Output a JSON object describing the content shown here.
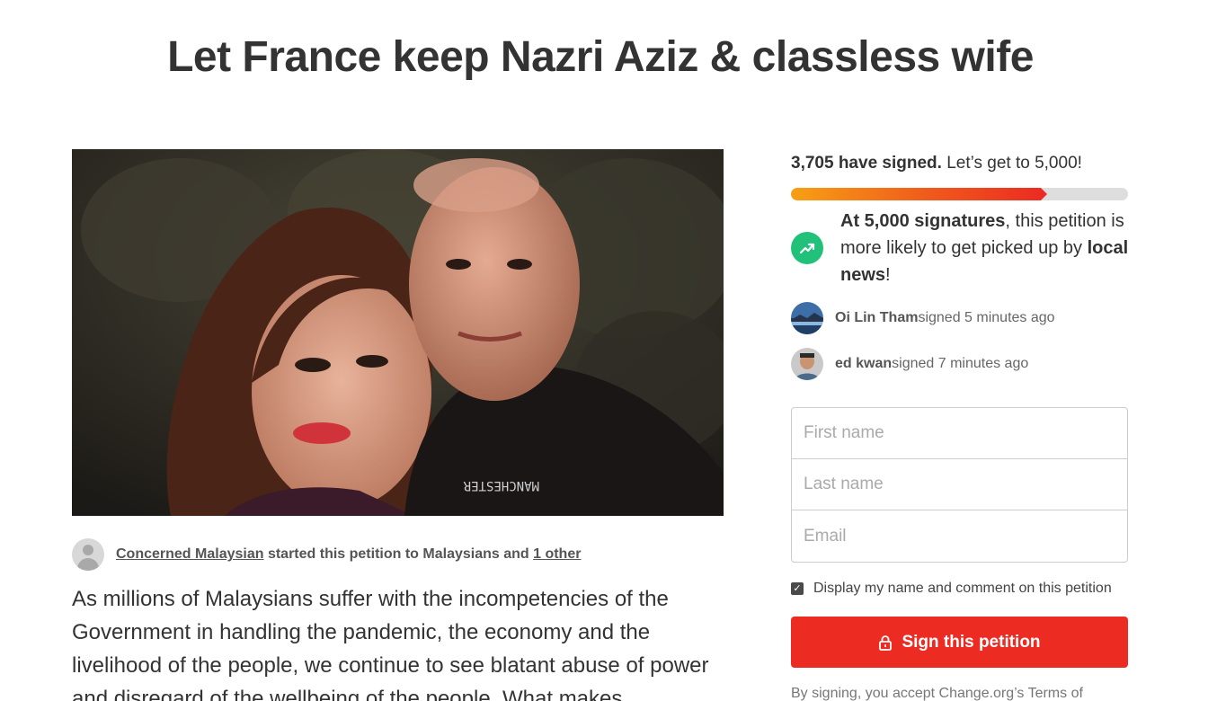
{
  "petition": {
    "title": "Let France keep Nazri Aziz & classless wife",
    "photo_alt": "petition-photo",
    "author": {
      "name": "Concerned Malaysian",
      "started_text": " started this petition to Malaysians and ",
      "other": "1 other"
    },
    "description": "As millions of Malaysians suffer with the incompetencies of the Government in handling the pandemic, the economy and the livelihood of the people, we continue to see blatant abuse of power and disregard of the wellbeing of the people. What makes"
  },
  "progress": {
    "signed_count": "3,705 have signed.",
    "goal_text": " Let’s get to 5,000!",
    "fraction": 0.741
  },
  "milestone": {
    "bold1": "At 5,000 signatures",
    "text1": ", this petition is more likely to get picked up by ",
    "bold2": "local news",
    "text2": "!",
    "icon": "trending-up-icon"
  },
  "recent_signers": [
    {
      "name": "Oi Lin Tham",
      "action": " signed 5 minutes ago"
    },
    {
      "name": "ed kwan",
      "action": " signed 7 minutes ago"
    }
  ],
  "form": {
    "first_name_placeholder": "First name",
    "last_name_placeholder": "Last name",
    "email_placeholder": "Email",
    "consent_label": "Display my name and comment on this petition",
    "consent_checked": true,
    "sign_button": "Sign this petition",
    "terms_text": "By signing, you accept Change.org’s Terms of"
  },
  "colors": {
    "accent": "#ec2c22",
    "progress_start": "#f7a014",
    "milestone_green": "#22c17a"
  }
}
